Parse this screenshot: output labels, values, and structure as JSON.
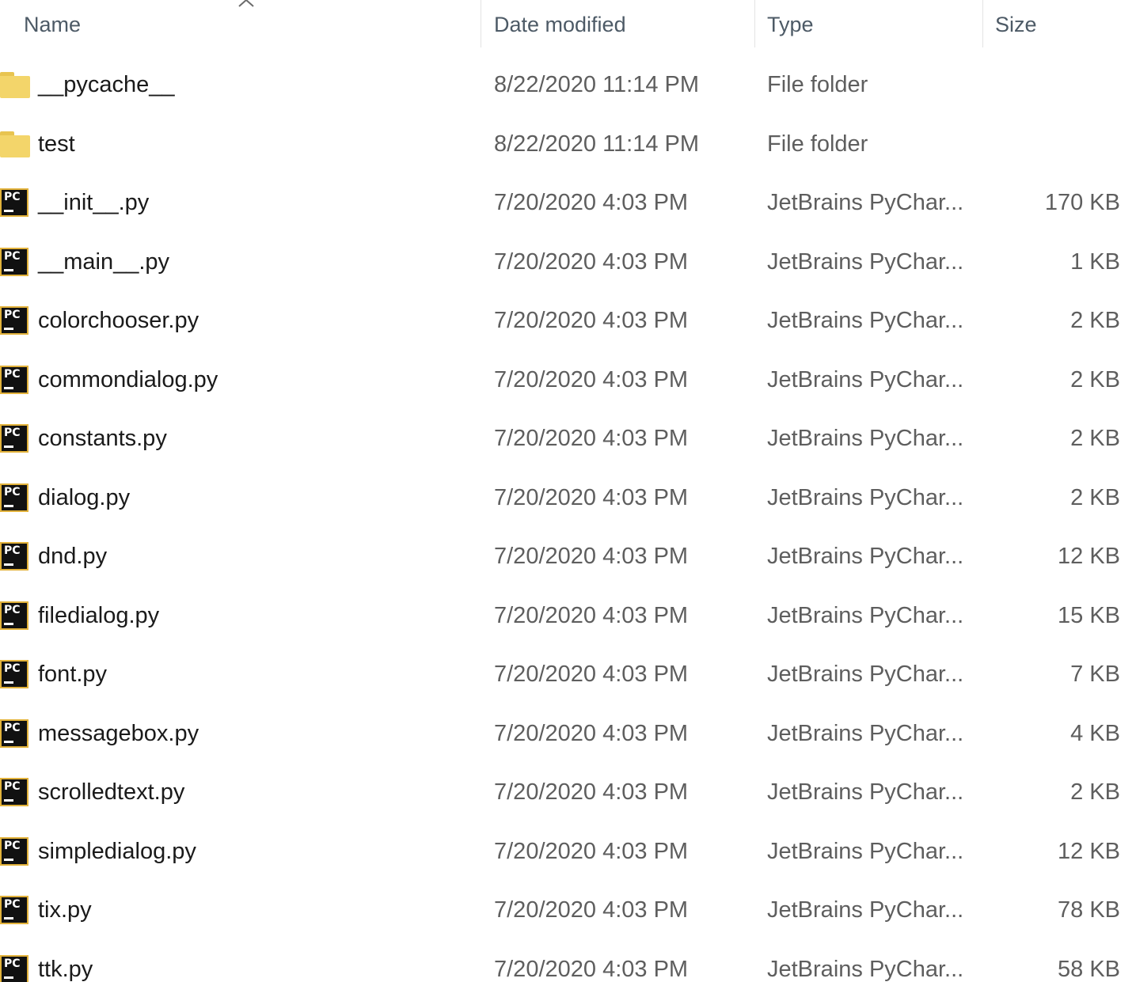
{
  "header": {
    "name_label": "Name",
    "date_label": "Date modified",
    "type_label": "Type",
    "size_label": "Size"
  },
  "icons": {
    "folder": "folder-icon",
    "python": "pycharm-file-icon",
    "pc_glyph": "PC"
  },
  "files": [
    {
      "name": "__pycache__",
      "date": "8/22/2020 11:14 PM",
      "type": "File folder",
      "size": "",
      "kind": "folder"
    },
    {
      "name": "test",
      "date": "8/22/2020 11:14 PM",
      "type": "File folder",
      "size": "",
      "kind": "folder"
    },
    {
      "name": "__init__.py",
      "date": "7/20/2020 4:03 PM",
      "type": "JetBrains PyChar...",
      "size": "170 KB",
      "kind": "py"
    },
    {
      "name": "__main__.py",
      "date": "7/20/2020 4:03 PM",
      "type": "JetBrains PyChar...",
      "size": "1 KB",
      "kind": "py"
    },
    {
      "name": "colorchooser.py",
      "date": "7/20/2020 4:03 PM",
      "type": "JetBrains PyChar...",
      "size": "2 KB",
      "kind": "py"
    },
    {
      "name": "commondialog.py",
      "date": "7/20/2020 4:03 PM",
      "type": "JetBrains PyChar...",
      "size": "2 KB",
      "kind": "py"
    },
    {
      "name": "constants.py",
      "date": "7/20/2020 4:03 PM",
      "type": "JetBrains PyChar...",
      "size": "2 KB",
      "kind": "py"
    },
    {
      "name": "dialog.py",
      "date": "7/20/2020 4:03 PM",
      "type": "JetBrains PyChar...",
      "size": "2 KB",
      "kind": "py"
    },
    {
      "name": "dnd.py",
      "date": "7/20/2020 4:03 PM",
      "type": "JetBrains PyChar...",
      "size": "12 KB",
      "kind": "py"
    },
    {
      "name": "filedialog.py",
      "date": "7/20/2020 4:03 PM",
      "type": "JetBrains PyChar...",
      "size": "15 KB",
      "kind": "py"
    },
    {
      "name": "font.py",
      "date": "7/20/2020 4:03 PM",
      "type": "JetBrains PyChar...",
      "size": "7 KB",
      "kind": "py"
    },
    {
      "name": "messagebox.py",
      "date": "7/20/2020 4:03 PM",
      "type": "JetBrains PyChar...",
      "size": "4 KB",
      "kind": "py"
    },
    {
      "name": "scrolledtext.py",
      "date": "7/20/2020 4:03 PM",
      "type": "JetBrains PyChar...",
      "size": "2 KB",
      "kind": "py"
    },
    {
      "name": "simpledialog.py",
      "date": "7/20/2020 4:03 PM",
      "type": "JetBrains PyChar...",
      "size": "12 KB",
      "kind": "py"
    },
    {
      "name": "tix.py",
      "date": "7/20/2020 4:03 PM",
      "type": "JetBrains PyChar...",
      "size": "78 KB",
      "kind": "py"
    },
    {
      "name": "ttk.py",
      "date": "7/20/2020 4:03 PM",
      "type": "JetBrains PyChar...",
      "size": "58 KB",
      "kind": "py"
    }
  ]
}
